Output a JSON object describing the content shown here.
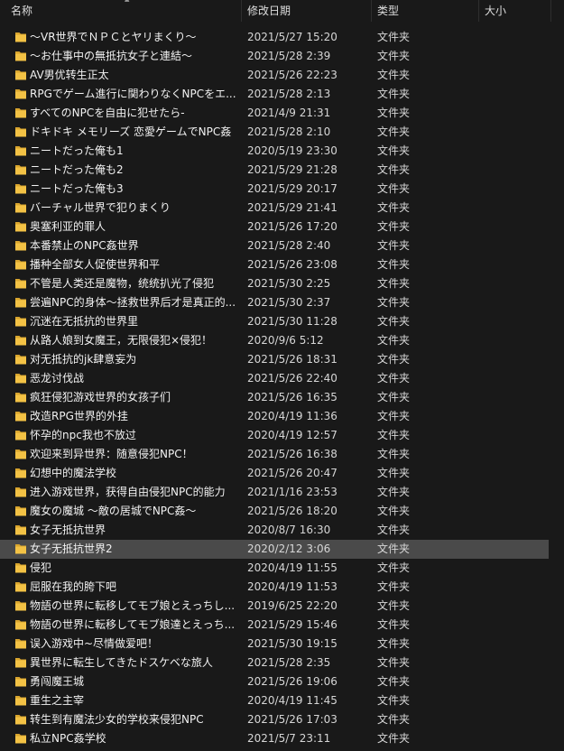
{
  "header": {
    "name_label": "名称",
    "date_label": "修改日期",
    "type_label": "类型",
    "size_label": "大小"
  },
  "colors": {
    "background": "#191919",
    "selected_row": "#4a4a4a",
    "folder": "#f3c245"
  },
  "selected_index": 27,
  "files": [
    {
      "name": "～VR世界でＮＰＣとヤリまくり～",
      "date": "2021/5/27 15:20",
      "type": "文件夹",
      "size": ""
    },
    {
      "name": "～お仕事中の無抵抗女子と連結～",
      "date": "2021/5/28 2:39",
      "type": "文件夹",
      "size": ""
    },
    {
      "name": "AV男优转生正太",
      "date": "2021/5/26 22:23",
      "type": "文件夹",
      "size": ""
    },
    {
      "name": "RPGでゲーム進行に関わりなくNPCをエ...",
      "date": "2021/5/28 2:13",
      "type": "文件夹",
      "size": ""
    },
    {
      "name": "すべてのNPCを自由に犯せたら-",
      "date": "2021/4/9 21:31",
      "type": "文件夹",
      "size": ""
    },
    {
      "name": "ドキドキ メモリーズ 恋愛ゲームでNPC姦",
      "date": "2021/5/28 2:10",
      "type": "文件夹",
      "size": ""
    },
    {
      "name": "ニートだった俺も1",
      "date": "2020/5/19 23:30",
      "type": "文件夹",
      "size": ""
    },
    {
      "name": "ニートだった俺も2",
      "date": "2021/5/29 21:28",
      "type": "文件夹",
      "size": ""
    },
    {
      "name": "ニートだった俺も3",
      "date": "2021/5/29 20:17",
      "type": "文件夹",
      "size": ""
    },
    {
      "name": "バーチャル世界で犯りまくり",
      "date": "2021/5/29 21:41",
      "type": "文件夹",
      "size": ""
    },
    {
      "name": "奥塞利亚的罪人",
      "date": "2021/5/26 17:20",
      "type": "文件夹",
      "size": ""
    },
    {
      "name": "本番禁止のNPC姦世界",
      "date": "2021/5/28 2:40",
      "type": "文件夹",
      "size": ""
    },
    {
      "name": "播种全部女人促使世界和平",
      "date": "2021/5/26 23:08",
      "type": "文件夹",
      "size": ""
    },
    {
      "name": "不管是人类还是魔物，统统扒光了侵犯",
      "date": "2021/5/30 2:25",
      "type": "文件夹",
      "size": ""
    },
    {
      "name": "尝遍NPC的身体～拯救世界后才是真正的...",
      "date": "2021/5/30 2:37",
      "type": "文件夹",
      "size": ""
    },
    {
      "name": "沉迷在无抵抗的世界里",
      "date": "2021/5/30 11:28",
      "type": "文件夹",
      "size": ""
    },
    {
      "name": "从路人娘到女魔王，无限侵犯×侵犯！",
      "date": "2020/9/6 5:12",
      "type": "文件夹",
      "size": ""
    },
    {
      "name": "对无抵抗的jk肆意妄为",
      "date": "2021/5/26 18:31",
      "type": "文件夹",
      "size": ""
    },
    {
      "name": "恶龙讨伐战",
      "date": "2021/5/26 22:40",
      "type": "文件夹",
      "size": ""
    },
    {
      "name": "疯狂侵犯游戏世界的女孩子们",
      "date": "2021/5/26 16:35",
      "type": "文件夹",
      "size": ""
    },
    {
      "name": "改造RPG世界的外挂",
      "date": "2020/4/19 11:36",
      "type": "文件夹",
      "size": ""
    },
    {
      "name": "怀孕的npc我也不放过",
      "date": "2020/4/19 12:57",
      "type": "文件夹",
      "size": ""
    },
    {
      "name": "欢迎来到异世界：随意侵犯NPC！",
      "date": "2021/5/26 16:38",
      "type": "文件夹",
      "size": ""
    },
    {
      "name": "幻想中的魔法学校",
      "date": "2021/5/26 20:47",
      "type": "文件夹",
      "size": ""
    },
    {
      "name": "进入游戏世界，获得自由侵犯NPC的能力",
      "date": "2021/1/16 23:53",
      "type": "文件夹",
      "size": ""
    },
    {
      "name": "魔女の魔城 ～敵の居城でNPC姦～",
      "date": "2021/5/26 18:20",
      "type": "文件夹",
      "size": ""
    },
    {
      "name": "女子无抵抗世界",
      "date": "2020/8/7 16:30",
      "type": "文件夹",
      "size": ""
    },
    {
      "name": "女子无抵抗世界2",
      "date": "2020/2/12 3:06",
      "type": "文件夹",
      "size": ""
    },
    {
      "name": "侵犯",
      "date": "2020/4/19 11:55",
      "type": "文件夹",
      "size": ""
    },
    {
      "name": "屈服在我的胯下吧",
      "date": "2020/4/19 11:53",
      "type": "文件夹",
      "size": ""
    },
    {
      "name": "物語の世界に転移してモブ娘とえっちし...",
      "date": "2019/6/25 22:20",
      "type": "文件夹",
      "size": ""
    },
    {
      "name": "物語の世界に転移してモブ娘達とえっち...",
      "date": "2021/5/29 15:46",
      "type": "文件夹",
      "size": ""
    },
    {
      "name": "误入游戏中~尽情做爱吧！",
      "date": "2021/5/30 19:15",
      "type": "文件夹",
      "size": ""
    },
    {
      "name": "異世界に転生してきたドスケベな旅人",
      "date": "2021/5/28 2:35",
      "type": "文件夹",
      "size": ""
    },
    {
      "name": "勇闯魔王城",
      "date": "2021/5/26 19:06",
      "type": "文件夹",
      "size": ""
    },
    {
      "name": "重生之主宰",
      "date": "2020/4/19 11:45",
      "type": "文件夹",
      "size": ""
    },
    {
      "name": "转生到有魔法少女的学校来侵犯NPC",
      "date": "2021/5/26 17:03",
      "type": "文件夹",
      "size": ""
    },
    {
      "name": "私立NPC姦学校",
      "date": "2021/5/7 23:11",
      "type": "文件夹",
      "size": ""
    }
  ]
}
